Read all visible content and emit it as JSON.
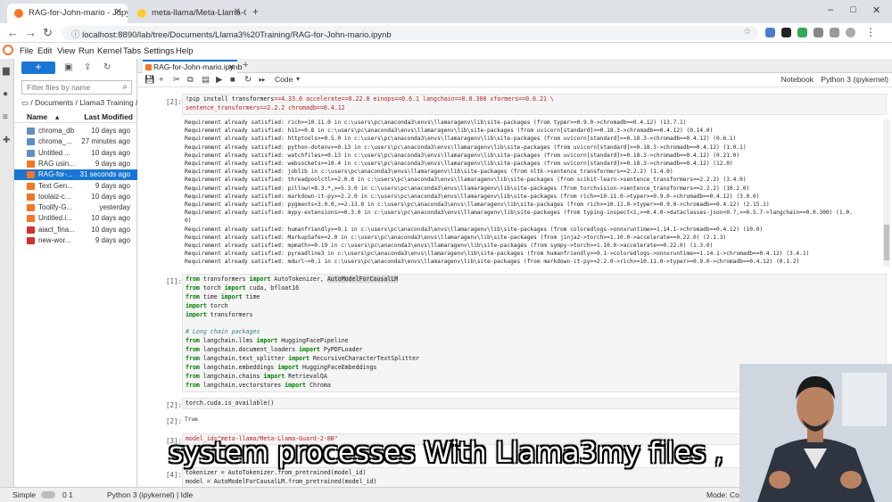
{
  "browser": {
    "tabs": [
      {
        "title": "RAG-for-John-mario - JupyterLab",
        "active": true
      },
      {
        "title": "meta-llama/Meta-Llama-Guard-2",
        "active": false
      }
    ],
    "new_tab": "+",
    "url": "localhost:8890/lab/tree/Documents/Llama3%20Training/RAG-for-John-mario.ipynb",
    "window_controls": [
      "–",
      "□",
      "✕"
    ]
  },
  "menu": [
    "File",
    "Edit",
    "View",
    "Run",
    "Kernel",
    "Tabs",
    "Settings",
    "Help"
  ],
  "filebrowser": {
    "new_button": "+",
    "filter_placeholder": "Filter files by name",
    "path": "/ Documents / Llama3 Training /",
    "col_name": "Name",
    "col_modified": "Last Modified",
    "files": [
      {
        "name": "chroma_db",
        "modified": "10 days ago",
        "type": "folder"
      },
      {
        "name": "chroma_...",
        "modified": "27 minutes ago",
        "type": "folder"
      },
      {
        "name": "Untitled ...",
        "modified": "10 days ago",
        "type": "folder"
      },
      {
        "name": "RAG usin...",
        "modified": "9 days ago",
        "type": "notebook"
      },
      {
        "name": "RAG-for-...",
        "modified": "31 seconds ago",
        "type": "notebook",
        "selected": true
      },
      {
        "name": "Text Gen...",
        "modified": "9 days ago",
        "type": "notebook"
      },
      {
        "name": "toolaiz-c...",
        "modified": "10 days ago",
        "type": "notebook"
      },
      {
        "name": "Toolify-G...",
        "modified": "yesterday",
        "type": "notebook"
      },
      {
        "name": "Untitled.i...",
        "modified": "10 days ago",
        "type": "notebook"
      },
      {
        "name": "aiact_fina...",
        "modified": "10 days ago",
        "type": "pdf"
      },
      {
        "name": "new-wor...",
        "modified": "9 days ago",
        "type": "pdf"
      }
    ]
  },
  "notebook": {
    "tab_title": "RAG-for-John-mario.ipynb",
    "cell_type": "Code",
    "notebook_link": "Notebook",
    "kernel": "Python 3 (ipykernel)",
    "cells": {
      "c2_prompt": "[2]:",
      "c2_line1a": "!pip install transformers",
      "c2_line1b": "==4.33.0 accelerate==0.22.0 einops==0.6.1 langchain==0.0.300 xformers==0.0.21 \\",
      "c2_line2": "sentence_transformers==2.2.2 chromadb==0.4.12",
      "c3_prompt": "[1]:",
      "c4_prompt": "[2]:",
      "c4_code": "torch.cuda.is_available()",
      "c4_out_prompt": "[2]:",
      "c4_out": "True",
      "c5_prompt": "[3]:",
      "c5_code": "model_id=\"meta-llama/Meta-Llama-Guard-2-8B\"",
      "c6_prompt": "[4]:",
      "c6_line1": "tokenizer = AutoTokenizer.from_pretrained(model_id)",
      "c6_line2": "model = AutoModelForCausalLM.from_pretrained(model_id)"
    },
    "output_lines": [
      "Requirement already satisfied: rich>=10.11.0 in c:\\users\\pc\\anaconda3\\envs\\llamaragenv\\lib\\site-packages (from typer>=0.9.0->chromadb==0.4.12) (13.7.1)",
      "Requirement already satisfied: h11>=0.8 in c:\\users\\pc\\anaconda3\\envs\\llamaragenv\\lib\\site-packages (from uvicorn[standard]>=0.18.3->chromadb==0.4.12) (0.14.0)",
      "Requirement already satisfied: httptools>=0.5.0 in c:\\users\\pc\\anaconda3\\envs\\llamaragenv\\lib\\site-packages (from uvicorn[standard]>=0.18.3->chromadb==0.4.12) (0.6.1)",
      "Requirement already satisfied: python-dotenv>=0.13 in c:\\users\\pc\\anaconda3\\envs\\llamaragenv\\lib\\site-packages (from uvicorn[standard]>=0.18.3->chromadb==0.4.12) (1.0.1)",
      "Requirement already satisfied: watchfiles>=0.13 in c:\\users\\pc\\anaconda3\\envs\\llamaragenv\\lib\\site-packages (from uvicorn[standard]>=0.18.3->chromadb==0.4.12) (0.21.0)",
      "Requirement already satisfied: websockets>=10.4 in c:\\users\\pc\\anaconda3\\envs\\llamaragenv\\lib\\site-packages (from uvicorn[standard]>=0.18.3->chromadb==0.4.12) (12.0)",
      "Requirement already satisfied: joblib in c:\\users\\pc\\anaconda3\\envs\\llamaragenv\\lib\\site-packages (from nltk->sentence_transformers==2.2.2) (1.4.0)",
      "Requirement already satisfied: threadpoolctl>=2.0.0 in c:\\users\\pc\\anaconda3\\envs\\llamaragenv\\lib\\site-packages (from scikit-learn->sentence_transformers==2.2.2) (3.4.0)",
      "Requirement already satisfied: pillow!=8.3.*,>=5.3.0 in c:\\users\\pc\\anaconda3\\envs\\llamaragenv\\lib\\site-packages (from torchvision->sentence_transformers==2.2.2) (10.2.0)",
      "Requirement already satisfied: markdown-it-py>=2.2.0 in c:\\users\\pc\\anaconda3\\envs\\llamaragenv\\lib\\site-packages (from rich>=10.11.0->typer>=0.9.0->chromadb==0.4.12) (3.0.0)",
      "Requirement already satisfied: pygments<3.0.0,>=2.13.0 in c:\\users\\pc\\anaconda3\\envs\\llamaragenv\\lib\\site-packages (from rich>=10.11.0->typer>=0.9.0->chromadb==0.4.12) (2.15.1)",
      "Requirement already satisfied: mypy-extensions>=0.3.0 in c:\\users\\pc\\anaconda3\\envs\\llamaragenv\\lib\\site-packages (from typing-inspect<1,>=0.4.0->dataclasses-json<0.7,>=0.5.7->langchain==0.0.300) (1.0.",
      "0)",
      "Requirement already satisfied: humanfriendly>=9.1 in c:\\users\\pc\\anaconda3\\envs\\llamaragenv\\lib\\site-packages (from coloredlogs->onnxruntime>=1.14.1->chromadb==0.4.12) (10.0)",
      "Requirement already satisfied: MarkupSafe>=2.0 in c:\\users\\pc\\anaconda3\\envs\\llamaragenv\\lib\\site-packages (from jinja2->torch>=1.10.0->accelerate==0.22.0) (2.1.3)",
      "Requirement already satisfied: mpmath>=0.19 in c:\\users\\pc\\anaconda3\\envs\\llamaragenv\\lib\\site-packages (from sympy->torch>=1.10.0->accelerate==0.22.0) (1.3.0)",
      "Requirement already satisfied: pyreadline3 in c:\\users\\pc\\anaconda3\\envs\\llamaragenv\\lib\\site-packages (from humanfriendly>=9.1->coloredlogs->onnxruntime>=1.14.1->chromadb==0.4.12) (3.4.1)",
      "Requirement already satisfied: mdurl~=0.1 in c:\\users\\pc\\anaconda3\\envs\\llamaragenv\\lib\\site-packages (from markdown-it-py>=2.2.0->rich>=10.11.0->typer>=0.9.0->chromadb==0.4.12) (0.1.2)"
    ],
    "import_lines": [
      {
        "kw": "from",
        "mod": "transformers",
        "imp": "import",
        "names": "AutoTokenizer, ",
        "hl": "AutoModelForCausalLM"
      },
      {
        "kw": "from",
        "mod": "torch",
        "imp": "import",
        "names": "cuda, bfloat16",
        "hl": ""
      },
      {
        "kw": "from",
        "mod": "time",
        "imp": "import",
        "names": "time",
        "hl": ""
      },
      {
        "kw": "",
        "mod": "",
        "imp": "import",
        "names": "torch",
        "hl": ""
      },
      {
        "kw": "",
        "mod": "",
        "imp": "import",
        "names": "transformers",
        "hl": ""
      },
      {
        "kw": "",
        "mod": "",
        "imp": "",
        "names": "",
        "hl": ""
      },
      {
        "kw": "comment",
        "mod": "",
        "imp": "",
        "names": "# Long chain packages",
        "hl": ""
      },
      {
        "kw": "from",
        "mod": "langchain.llms",
        "imp": "import",
        "names": "HuggingFacePipeline",
        "hl": ""
      },
      {
        "kw": "from",
        "mod": "langchain.document_loaders",
        "imp": "import",
        "names": "PyPDFLoader",
        "hl": ""
      },
      {
        "kw": "from",
        "mod": "langchain.text_splitter",
        "imp": "import",
        "names": "RecursiveCharacterTextSplitter",
        "hl": ""
      },
      {
        "kw": "from",
        "mod": "langchain.embeddings",
        "imp": "import",
        "names": "HuggingFaceEmbeddings",
        "hl": ""
      },
      {
        "kw": "from",
        "mod": "langchain.chains",
        "imp": "import",
        "names": "RetrievalQA",
        "hl": ""
      },
      {
        "kw": "from",
        "mod": "langchain.vectorstores",
        "imp": "import",
        "names": "Chroma",
        "hl": ""
      }
    ]
  },
  "status": {
    "mode": "Simple",
    "counts": "0   1",
    "kernel_status": "Python 3 (ipykernel) | Idle",
    "right": "Mode: Com"
  },
  "subtitle": "system processes With Llama3my files ,",
  "colors": {
    "accent": "#1976d2",
    "keyword": "#008000",
    "comment": "#408080",
    "string": "#ba2121"
  }
}
